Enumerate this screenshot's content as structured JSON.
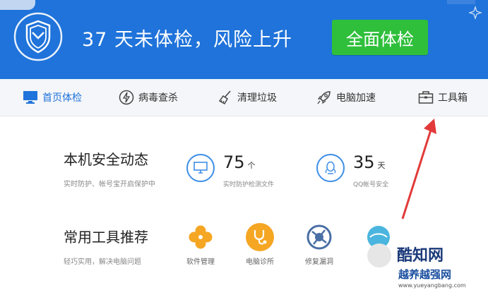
{
  "header": {
    "headline": "37 天未体检，风险上升",
    "check_button": "全面体检"
  },
  "nav": {
    "items": [
      {
        "label": "首页体检",
        "icon": "monitor-icon"
      },
      {
        "label": "病毒查杀",
        "icon": "lightning-circle-icon"
      },
      {
        "label": "清理垃圾",
        "icon": "broom-icon"
      },
      {
        "label": "电脑加速",
        "icon": "rocket-icon"
      },
      {
        "label": "工具箱",
        "icon": "toolbox-icon"
      }
    ]
  },
  "security": {
    "title": "本机安全动态",
    "subtitle": "实时防护、帐号宝开启保护中",
    "stats": [
      {
        "value": "75",
        "unit": "个",
        "label": "实时防护检测文件",
        "icon": "monitor-icon"
      },
      {
        "value": "35",
        "unit": "天",
        "label": "QQ帐号安全",
        "icon": "qq-penguin-icon"
      }
    ]
  },
  "tools": {
    "title": "常用工具推荐",
    "subtitle": "轻巧实用，解决电脑问题",
    "items": [
      {
        "label": "软件管理",
        "color": "#f5a623",
        "icon": "clover-icon"
      },
      {
        "label": "电脑诊所",
        "color": "#f5a623",
        "icon": "stethoscope-icon"
      },
      {
        "label": "修复漏洞",
        "color": "#4a6fa5",
        "icon": "globe-icon"
      }
    ]
  },
  "watermark": {
    "brand": "酷知网",
    "brand2": "越养越强网",
    "url": "www.yueyangbang.com"
  },
  "colors": {
    "header_bg": "#1f73da",
    "check_button_bg": "#2fbf3b",
    "accent_blue": "#3d8ee8",
    "arrow_red": "#e23a3a"
  }
}
